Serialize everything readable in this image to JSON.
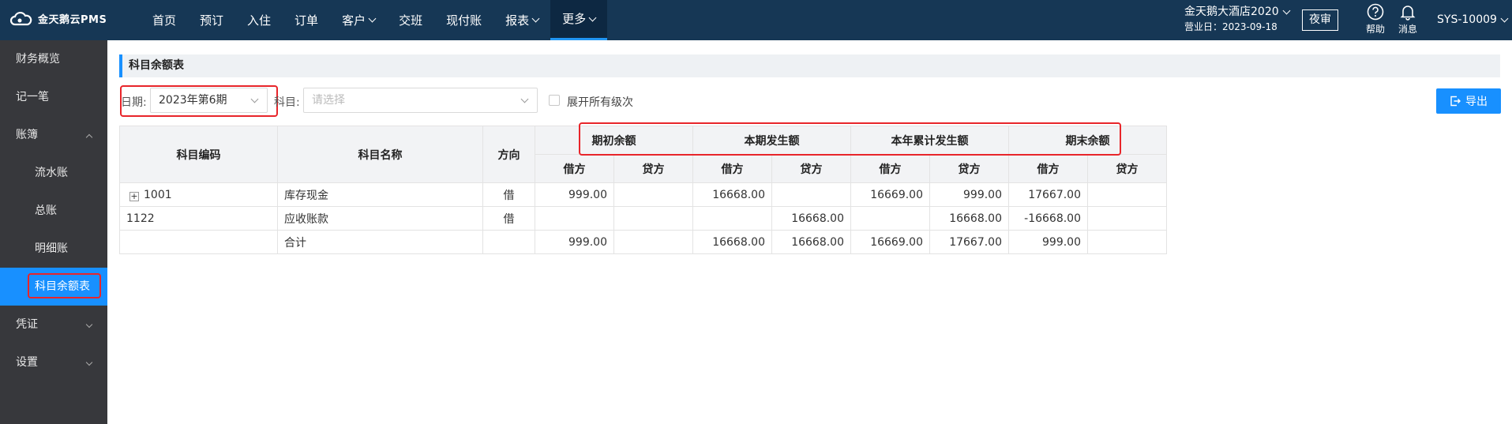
{
  "app": {
    "logo_text": "金天鹅云PMS"
  },
  "nav": {
    "items": [
      {
        "label": "首页",
        "has_dropdown": false
      },
      {
        "label": "预订",
        "has_dropdown": false
      },
      {
        "label": "入住",
        "has_dropdown": false
      },
      {
        "label": "订单",
        "has_dropdown": false
      },
      {
        "label": "客户",
        "has_dropdown": true
      },
      {
        "label": "交班",
        "has_dropdown": false
      },
      {
        "label": "现付账",
        "has_dropdown": false
      },
      {
        "label": "报表",
        "has_dropdown": true
      },
      {
        "label": "更多",
        "has_dropdown": true,
        "active": true
      }
    ]
  },
  "header": {
    "hotel_name": "金天鹅大酒店2020",
    "business_day": "营业日：2023-09-18",
    "night_audit": "夜审",
    "help": "帮助",
    "messages": "消息",
    "user": "SYS-10009"
  },
  "sidebar": {
    "items": [
      {
        "label": "财务概览"
      },
      {
        "label": "记一笔"
      },
      {
        "label": "账簿"
      },
      {
        "label": "流水账"
      },
      {
        "label": "总账"
      },
      {
        "label": "明细账"
      },
      {
        "label": "科目余额表"
      },
      {
        "label": "凭证"
      },
      {
        "label": "设置"
      }
    ]
  },
  "main": {
    "title": "科目余额表",
    "filters": {
      "date_label": "日期:",
      "date_value": "2023年第6期",
      "subject_label": "科目:",
      "subject_placeholder": "请选择",
      "expand_all_label": "展开所有级次"
    },
    "export_label": "导出",
    "table": {
      "headers": {
        "code": "科目编码",
        "name": "科目名称",
        "direction": "方向",
        "groups": [
          "期初余额",
          "本期发生额",
          "本年累计发生额",
          "期末余额"
        ],
        "debit": "借方",
        "credit": "贷方"
      },
      "rows": [
        {
          "code": "1001",
          "expandable": true,
          "name": "库存现金",
          "direction": "借",
          "values": [
            "999.00",
            "",
            "16668.00",
            "",
            "16669.00",
            "999.00",
            "17667.00",
            ""
          ]
        },
        {
          "code": "1122",
          "expandable": false,
          "name": "应收账款",
          "direction": "借",
          "values": [
            "",
            "",
            "",
            "16668.00",
            "",
            "16668.00",
            "-16668.00",
            ""
          ]
        },
        {
          "code": "",
          "expandable": false,
          "name": "合计",
          "direction": "",
          "values": [
            "999.00",
            "",
            "16668.00",
            "16668.00",
            "16669.00",
            "17667.00",
            "999.00",
            ""
          ]
        }
      ]
    }
  },
  "colors": {
    "topbar": "#163755",
    "sidebar": "#37383c",
    "accent": "#1890ff",
    "highlight_box": "#e8252a"
  }
}
